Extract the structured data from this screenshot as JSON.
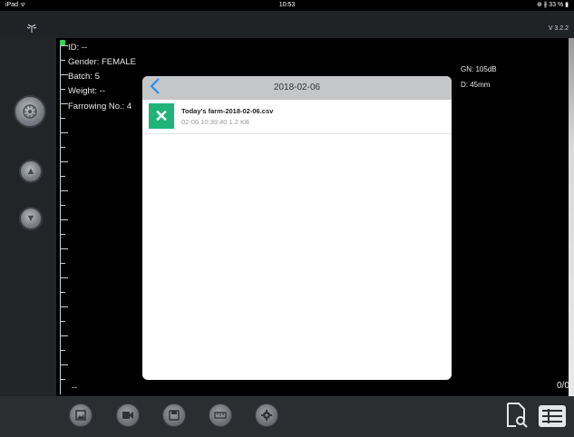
{
  "status_bar": {
    "left": "iPad ᯤ",
    "time": "10:53",
    "right": "⊕ ∦ 33 % ▮"
  },
  "app_bar": {
    "antenna_icon": "antenna-icon",
    "version": "V 3.2.2"
  },
  "left_controls": [
    {
      "name": "gain-knob",
      "icon": "settings-wheel-icon"
    },
    {
      "name": "up-button",
      "icon": "arrow-up-icon"
    },
    {
      "name": "down-button",
      "icon": "arrow-down-icon"
    }
  ],
  "info": {
    "id": "ID: --",
    "gender": "Gender: FEMALE",
    "batch": "Batch: 5",
    "weight": "Weight: --",
    "farrowing": "Farrowing No.: 4"
  },
  "right_info": {
    "gn": "GN:  105dB",
    "depth": "D:  45mm"
  },
  "bottom_left_text": "--",
  "counter": "0/0",
  "modal": {
    "title": "2018-02-06",
    "back_icon": "chevron-left-icon",
    "files": [
      {
        "name": "Today's farm-2018-02-06.csv",
        "meta": "02-06 10:39:40  1.2 KB",
        "icon": "excel-icon",
        "icon_color": "#21b27a"
      }
    ]
  },
  "toolbar": {
    "buttons": [
      {
        "name": "image-button",
        "icon": "image-icon"
      },
      {
        "name": "video-button",
        "icon": "video-camera-icon"
      },
      {
        "name": "save-button",
        "icon": "save-icon"
      },
      {
        "name": "measure-button",
        "icon": "ruler-icon"
      },
      {
        "name": "settings-button",
        "icon": "gear-icon"
      }
    ],
    "search_doc_icon": "document-search-icon",
    "list_icon": "list-icon"
  },
  "colors": {
    "accent": "#1f8bff",
    "excel": "#21b27a",
    "indicator": "#39d353"
  }
}
